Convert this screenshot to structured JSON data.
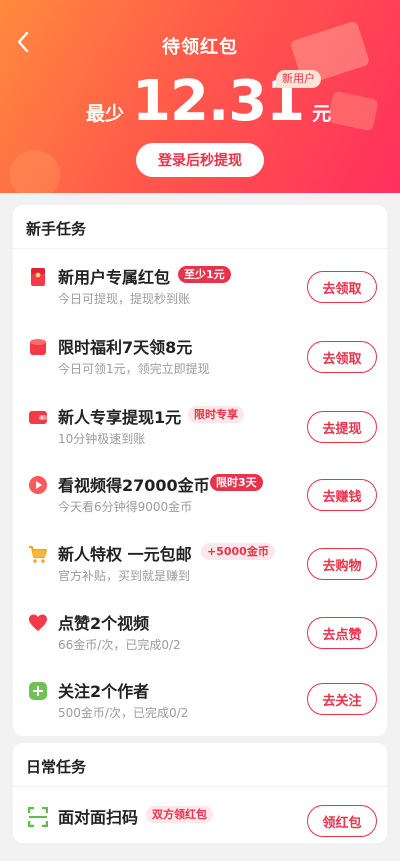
{
  "header": {
    "title": "待领红包",
    "amount_prefix": "最少",
    "amount": "12.31",
    "amount_unit": "元",
    "new_user_badge": "新用户",
    "login_button": "登录后秒提现"
  },
  "new_tasks": {
    "title": "新手任务",
    "items": [
      {
        "title": "新用户专属红包",
        "tag": "至少1元",
        "sub": "今日可提现，提现秒到账",
        "button": "去领取",
        "icon": "red-envelope-icon"
      },
      {
        "title": "限时福利7天领8元",
        "tag": "",
        "sub": "今日可领1元，领完立即提现",
        "button": "去领取",
        "icon": "red-packet-icon"
      },
      {
        "title": "新人专享提现1元",
        "tag": "限时专享",
        "sub": "10分钟极速到账",
        "button": "去提现",
        "icon": "wallet-icon"
      },
      {
        "title": "看视频得27000金币",
        "tag": "限时3天",
        "sub": "今天看6分钟得9000金币",
        "button": "去赚钱",
        "icon": "play-icon"
      },
      {
        "title": "新人特权 一元包邮",
        "tag": "+5000金币",
        "sub": "官方补贴，买到就是赚到",
        "button": "去购物",
        "icon": "cart-icon"
      },
      {
        "title": "点赞2个视频",
        "tag": "",
        "sub": "66金币/次，已完成0/2",
        "button": "去点赞",
        "icon": "heart-icon"
      },
      {
        "title": "关注2个作者",
        "tag": "",
        "sub": "500金币/次，已完成0/2",
        "button": "去关注",
        "icon": "add-user-icon"
      }
    ]
  },
  "daily_tasks": {
    "title": "日常任务",
    "items": [
      {
        "title": "面对面扫码",
        "tag": "双方领红包",
        "button": "领红包",
        "icon": "scan-icon"
      }
    ]
  },
  "colors": {
    "accent": "#e8334a",
    "header_start": "#ff8a3d",
    "header_end": "#ff2f5e"
  }
}
